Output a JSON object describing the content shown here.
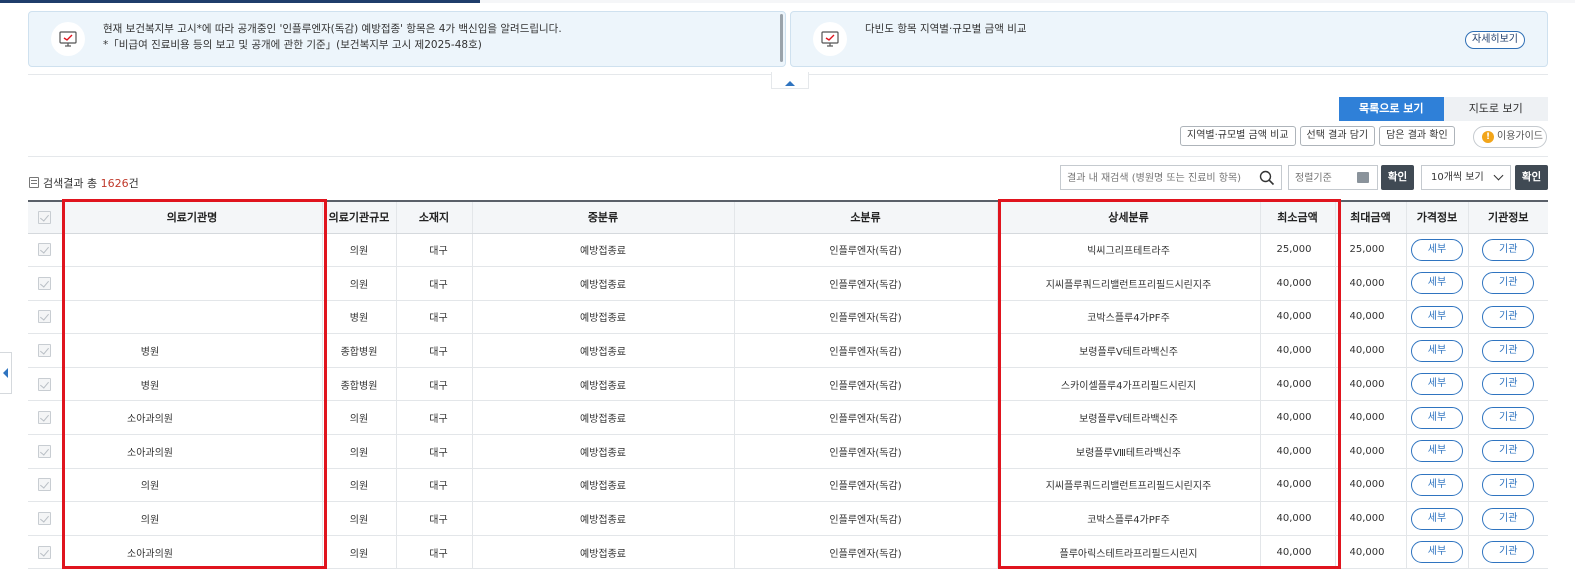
{
  "notices": {
    "left": {
      "icon": "monitor-check-icon",
      "line1": "현재 보건복지부 고시*에 따라 공개중인 '인플루엔자(독감) 예방접종' 항목은 4가 백신입을 알려드립니다.",
      "line2": "*「비급여 진료비용 등의 보고 및 공개에 관한 기준」(보건복지부 고시 제2025-48호)"
    },
    "right": {
      "icon": "monitor-check-icon",
      "text": "다빈도 항목 지역별·규모별 금액 비교",
      "detail_label": "자세히보기"
    }
  },
  "view_toggle": {
    "list_label": "목록으로 보기",
    "map_label": "지도로 보기",
    "active": "list"
  },
  "actions": {
    "compare_label": "지역별·규모별 금액 비교",
    "save_label": "선택 결과 담기",
    "check_label": "담은 결과 확인",
    "guide_label": "이용가이드"
  },
  "results": {
    "prefix": "검색결과 총 ",
    "count": "1626",
    "suffix": "건"
  },
  "search": {
    "placeholder": "결과 내 재검색 (병원명 또는 진료비 항목)",
    "icon": "search-icon"
  },
  "sort": {
    "placeholder": "정렬기준",
    "icon": "calendar-icon"
  },
  "confirm_label": "확인",
  "per_page": {
    "value": "10개씩 보기",
    "icon": "chevron-down-icon"
  },
  "columns": [
    "의료기관명",
    "의료기관규모",
    "소재지",
    "중분류",
    "소분류",
    "상세분류",
    "최소금액",
    "최대금액",
    "가격정보",
    "기관정보"
  ],
  "rows": [
    {
      "name": "",
      "size": "의원",
      "loc": "대구",
      "mid": "예방접종료",
      "sub": "인플루엔자(독감)",
      "detail": "빅씨그리프테트라주",
      "min": "25,000",
      "max": "25,000",
      "price_btn": "세부",
      "inst_btn": "기관"
    },
    {
      "name": "",
      "size": "의원",
      "loc": "대구",
      "mid": "예방접종료",
      "sub": "인플루엔자(독감)",
      "detail": "지씨플루쿼드리밸런트프리필드시린지주",
      "min": "40,000",
      "max": "40,000",
      "price_btn": "세부",
      "inst_btn": "기관"
    },
    {
      "name": "",
      "size": "병원",
      "loc": "대구",
      "mid": "예방접종료",
      "sub": "인플루엔자(독감)",
      "detail": "코박스플루4가PF주",
      "min": "40,000",
      "max": "40,000",
      "price_btn": "세부",
      "inst_btn": "기관"
    },
    {
      "name": "병원",
      "size": "종합병원",
      "loc": "대구",
      "mid": "예방접종료",
      "sub": "인플루엔자(독감)",
      "detail": "보령플루Ⅴ테트라백신주",
      "min": "40,000",
      "max": "40,000",
      "price_btn": "세부",
      "inst_btn": "기관"
    },
    {
      "name": "병원",
      "size": "종합병원",
      "loc": "대구",
      "mid": "예방접종료",
      "sub": "인플루엔자(독감)",
      "detail": "스카이셀플루4가프리필드시린지",
      "min": "40,000",
      "max": "40,000",
      "price_btn": "세부",
      "inst_btn": "기관"
    },
    {
      "name": "소아과의원",
      "size": "의원",
      "loc": "대구",
      "mid": "예방접종료",
      "sub": "인플루엔자(독감)",
      "detail": "보령플루Ⅴ테트라백신주",
      "min": "40,000",
      "max": "40,000",
      "price_btn": "세부",
      "inst_btn": "기관"
    },
    {
      "name": "소아과의원",
      "size": "의원",
      "loc": "대구",
      "mid": "예방접종료",
      "sub": "인플루엔자(독감)",
      "detail": "보령플루Ⅷ테트라백신주",
      "min": "40,000",
      "max": "40,000",
      "price_btn": "세부",
      "inst_btn": "기관"
    },
    {
      "name": "의원",
      "size": "의원",
      "loc": "대구",
      "mid": "예방접종료",
      "sub": "인플루엔자(독감)",
      "detail": "지씨플루쿼드리밸런트프리필드시린지주",
      "min": "40,000",
      "max": "40,000",
      "price_btn": "세부",
      "inst_btn": "기관"
    },
    {
      "name": "의원",
      "size": "의원",
      "loc": "대구",
      "mid": "예방접종료",
      "sub": "인플루엔자(독감)",
      "detail": "코박스플루4가PF주",
      "min": "40,000",
      "max": "40,000",
      "price_btn": "세부",
      "inst_btn": "기관"
    },
    {
      "name": "소아과의원",
      "size": "의원",
      "loc": "대구",
      "mid": "예방접종료",
      "sub": "인플루엔자(독감)",
      "detail": "플루아릭스테트라프리필드시린지",
      "min": "40,000",
      "max": "40,000",
      "price_btn": "세부",
      "inst_btn": "기관"
    }
  ],
  "colors": {
    "accent": "#2f80d8",
    "highlight": "#e0141e",
    "count": "#c0392b",
    "dark_button": "#404a54"
  }
}
